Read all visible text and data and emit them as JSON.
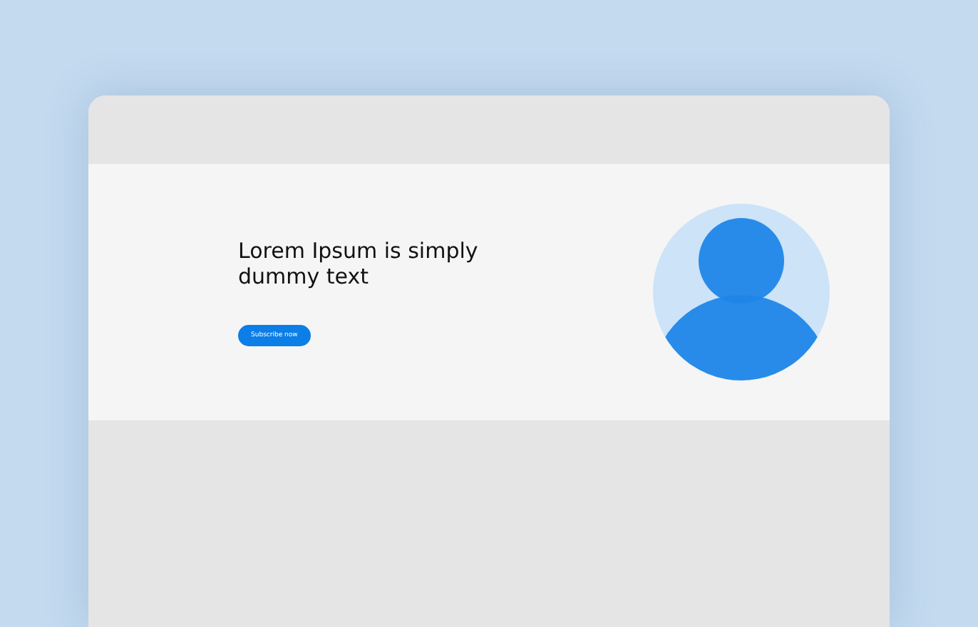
{
  "hero": {
    "heading": "Lorem Ipsum is simply dummy text",
    "button": "Subscribe now"
  }
}
